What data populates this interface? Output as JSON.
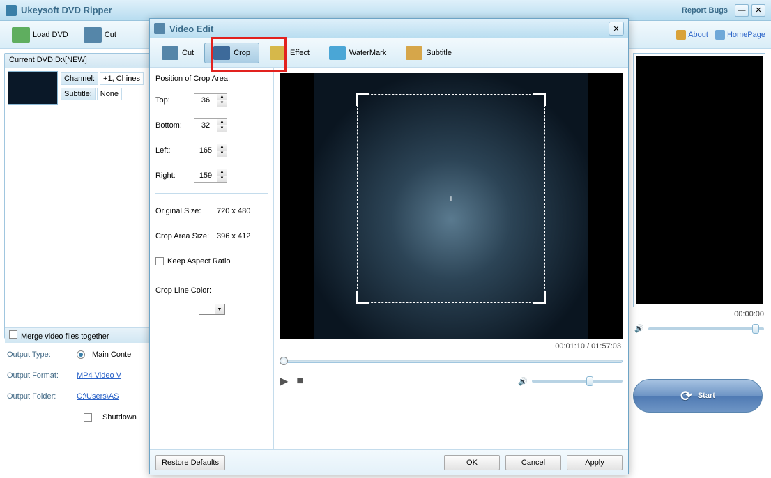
{
  "app": {
    "title": "Ukeysoft DVD Ripper",
    "report_bugs": "Report Bugs"
  },
  "toolbar": {
    "load": "Load DVD",
    "cut": "Cut",
    "about": "About",
    "home": "HomePage"
  },
  "dvd": {
    "current_label": "Current DVD:D:\\[NEW]",
    "channel_lbl": "Channel:",
    "channel_val": "+1, Chines",
    "subtitle_lbl": "Subtitle:",
    "subtitle_val": "None",
    "merge": "Merge video files together"
  },
  "opts": {
    "type_lbl": "Output Type:",
    "type_val": "Main Conte",
    "format_lbl": "Output Format:",
    "format_val": "MP4 Video V",
    "folder_lbl": "Output Folder:",
    "folder_val": "C:\\Users\\AS",
    "shutdown": "Shutdown"
  },
  "preview": {
    "time": "00:00:00"
  },
  "start": "Start",
  "modal": {
    "title": "Video Edit",
    "tabs": {
      "cut": "Cut",
      "crop": "Crop",
      "effect": "Effect",
      "watermark": "WaterMark",
      "subtitle": "Subtitle"
    },
    "pos_title": "Position of Crop Area:",
    "top_lbl": "Top:",
    "top": "36",
    "bottom_lbl": "Bottom:",
    "bottom": "32",
    "left_lbl": "Left:",
    "left": "165",
    "right_lbl": "Right:",
    "right": "159",
    "orig_lbl": "Original Size:",
    "orig": "720 x 480",
    "crop_lbl": "Crop Area Size:",
    "crop": "396 x 412",
    "keep": "Keep Aspect Ratio",
    "color_lbl": "Crop Line Color:",
    "curtime": "00:01:10 / 01:57:03",
    "restore": "Restore Defaults",
    "ok": "OK",
    "cancel": "Cancel",
    "apply": "Apply"
  }
}
